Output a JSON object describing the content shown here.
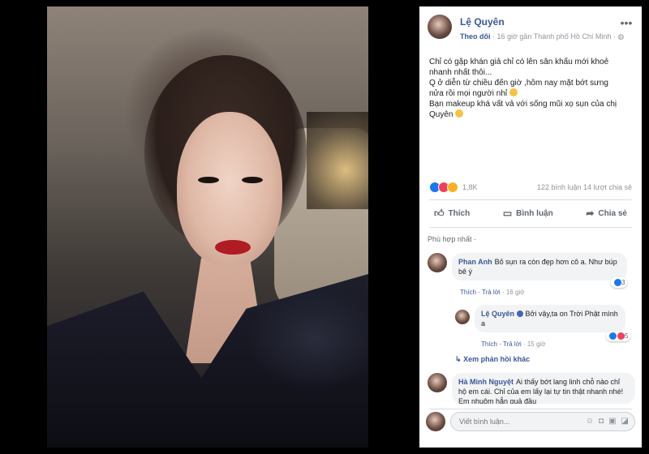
{
  "post": {
    "author": "Lệ Quyên",
    "follow_label": "Theo dõi",
    "meta": "· 16 giờ gần Thành phố Hồ Chí Minh ·",
    "text_lines": [
      "Chỉ có gặp khán giả chỉ có lên sân khấu mới khoẻ",
      "nhanh nhất thôi...",
      "Q ở diễn từ chiều đến giờ ,hôm nay mặt bớt sưng",
      "nửa rồi mọi người nhỉ",
      "Bạn makeup khá vất vả với sống mũi xọ sụn của chị",
      "Quyên"
    ],
    "reaction_count": "1,8K",
    "comments_count": "122 bình luận",
    "shares_count": "14 lượt chia sẻ",
    "actions": {
      "like": "Thích",
      "comment": "Bình luận",
      "share": "Chia sẻ"
    },
    "sort_label": "Phù hợp nhất ·"
  },
  "comments": [
    {
      "name": "Phan Anh",
      "text": "Bỏ sụn ra còn đẹp hơn cô a. Như búp bê ý",
      "like": "Thích",
      "reply": "Trả lời",
      "time": "· 16 giờ",
      "reacts": "3"
    },
    {
      "name": "Lệ Quyên",
      "text": "Bởi vậy,ta on Trời Phật mình a",
      "like": "Thích",
      "reply": "Trả lời",
      "time": "· 15 giờ",
      "reacts": "5"
    },
    {
      "name": "Hà Minh Nguyệt",
      "text": "Ai thấy bớt lang linh chỗ nào chỉ hộ em cái. Chỉ của em lấy lại tự tin thật nhanh nhé! Em nhuộm hẳn quả đầu"
    }
  ],
  "more_replies": "Xem phản hồi khác",
  "composer": {
    "placeholder": "Viết bình luận..."
  },
  "icons": {
    "more": "more-horizontal-icon",
    "globe": "globe-icon",
    "like": "thumbs-up-icon",
    "comment": "comment-icon",
    "share": "share-icon",
    "emoji": "emoji-icon",
    "camera": "camera-icon",
    "gif": "gif-icon",
    "sticker": "sticker-icon"
  },
  "colors": {
    "link": "#385898",
    "muted": "#90949c",
    "like_blue": "#1877f2",
    "love_red": "#f33e58"
  }
}
